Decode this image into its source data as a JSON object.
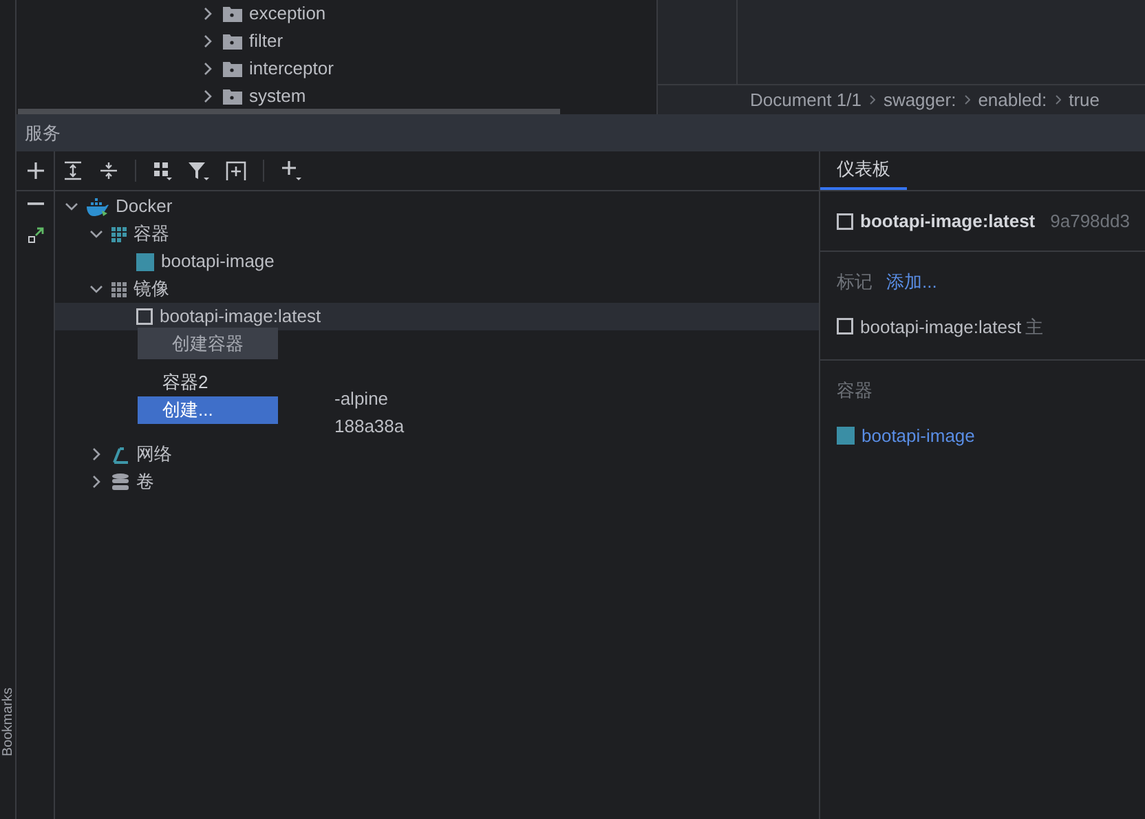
{
  "project_tree": [
    {
      "label": "exception",
      "expanded": false
    },
    {
      "label": "filter",
      "expanded": false
    },
    {
      "label": "interceptor",
      "expanded": false
    },
    {
      "label": "system",
      "expanded": false
    }
  ],
  "breadcrumbs": [
    "Document 1/1",
    "swagger:",
    "enabled:",
    "true"
  ],
  "services_panel": {
    "title": "服务",
    "tree": [
      {
        "label": "Docker",
        "kind": "docker",
        "expanded": true,
        "selected": false,
        "children": [
          {
            "label": "容器",
            "kind": "containers",
            "expanded": true,
            "selected": false,
            "children": [
              {
                "label": "bootapi-image",
                "kind": "container",
                "selected": false
              }
            ]
          },
          {
            "label": "镜像",
            "kind": "images",
            "expanded": true,
            "selected": false,
            "children": [
              {
                "label": "bootapi-image:latest",
                "kind": "image",
                "selected": true
              },
              {
                "label": "-alpine",
                "kind": "hidden",
                "selected": false
              },
              {
                "label": "188a38a",
                "kind": "hidden",
                "selected": false
              }
            ]
          },
          {
            "label": "网络",
            "kind": "networks",
            "expanded": false,
            "selected": false
          },
          {
            "label": "卷",
            "kind": "volumes",
            "expanded": false,
            "selected": false
          }
        ]
      }
    ],
    "context_menu": [
      {
        "label": "创建容器",
        "kind": "header"
      },
      {
        "label": "容器2",
        "kind": "item",
        "selected": false
      },
      {
        "label": "创建...",
        "kind": "item",
        "selected": true
      }
    ]
  },
  "dashboard": {
    "tabs": [
      {
        "label": "仪表板",
        "selected": true
      }
    ],
    "image_name": "bootapi-image:latest",
    "image_id": "9a798dd3",
    "tags_label": "标记",
    "add_link": "添加...",
    "tags": [
      {
        "name": "bootapi-image:latest",
        "note": "主"
      }
    ],
    "containers_label": "容器",
    "containers": [
      "bootapi-image"
    ]
  },
  "side_stripe": {
    "label": "Bookmarks"
  }
}
